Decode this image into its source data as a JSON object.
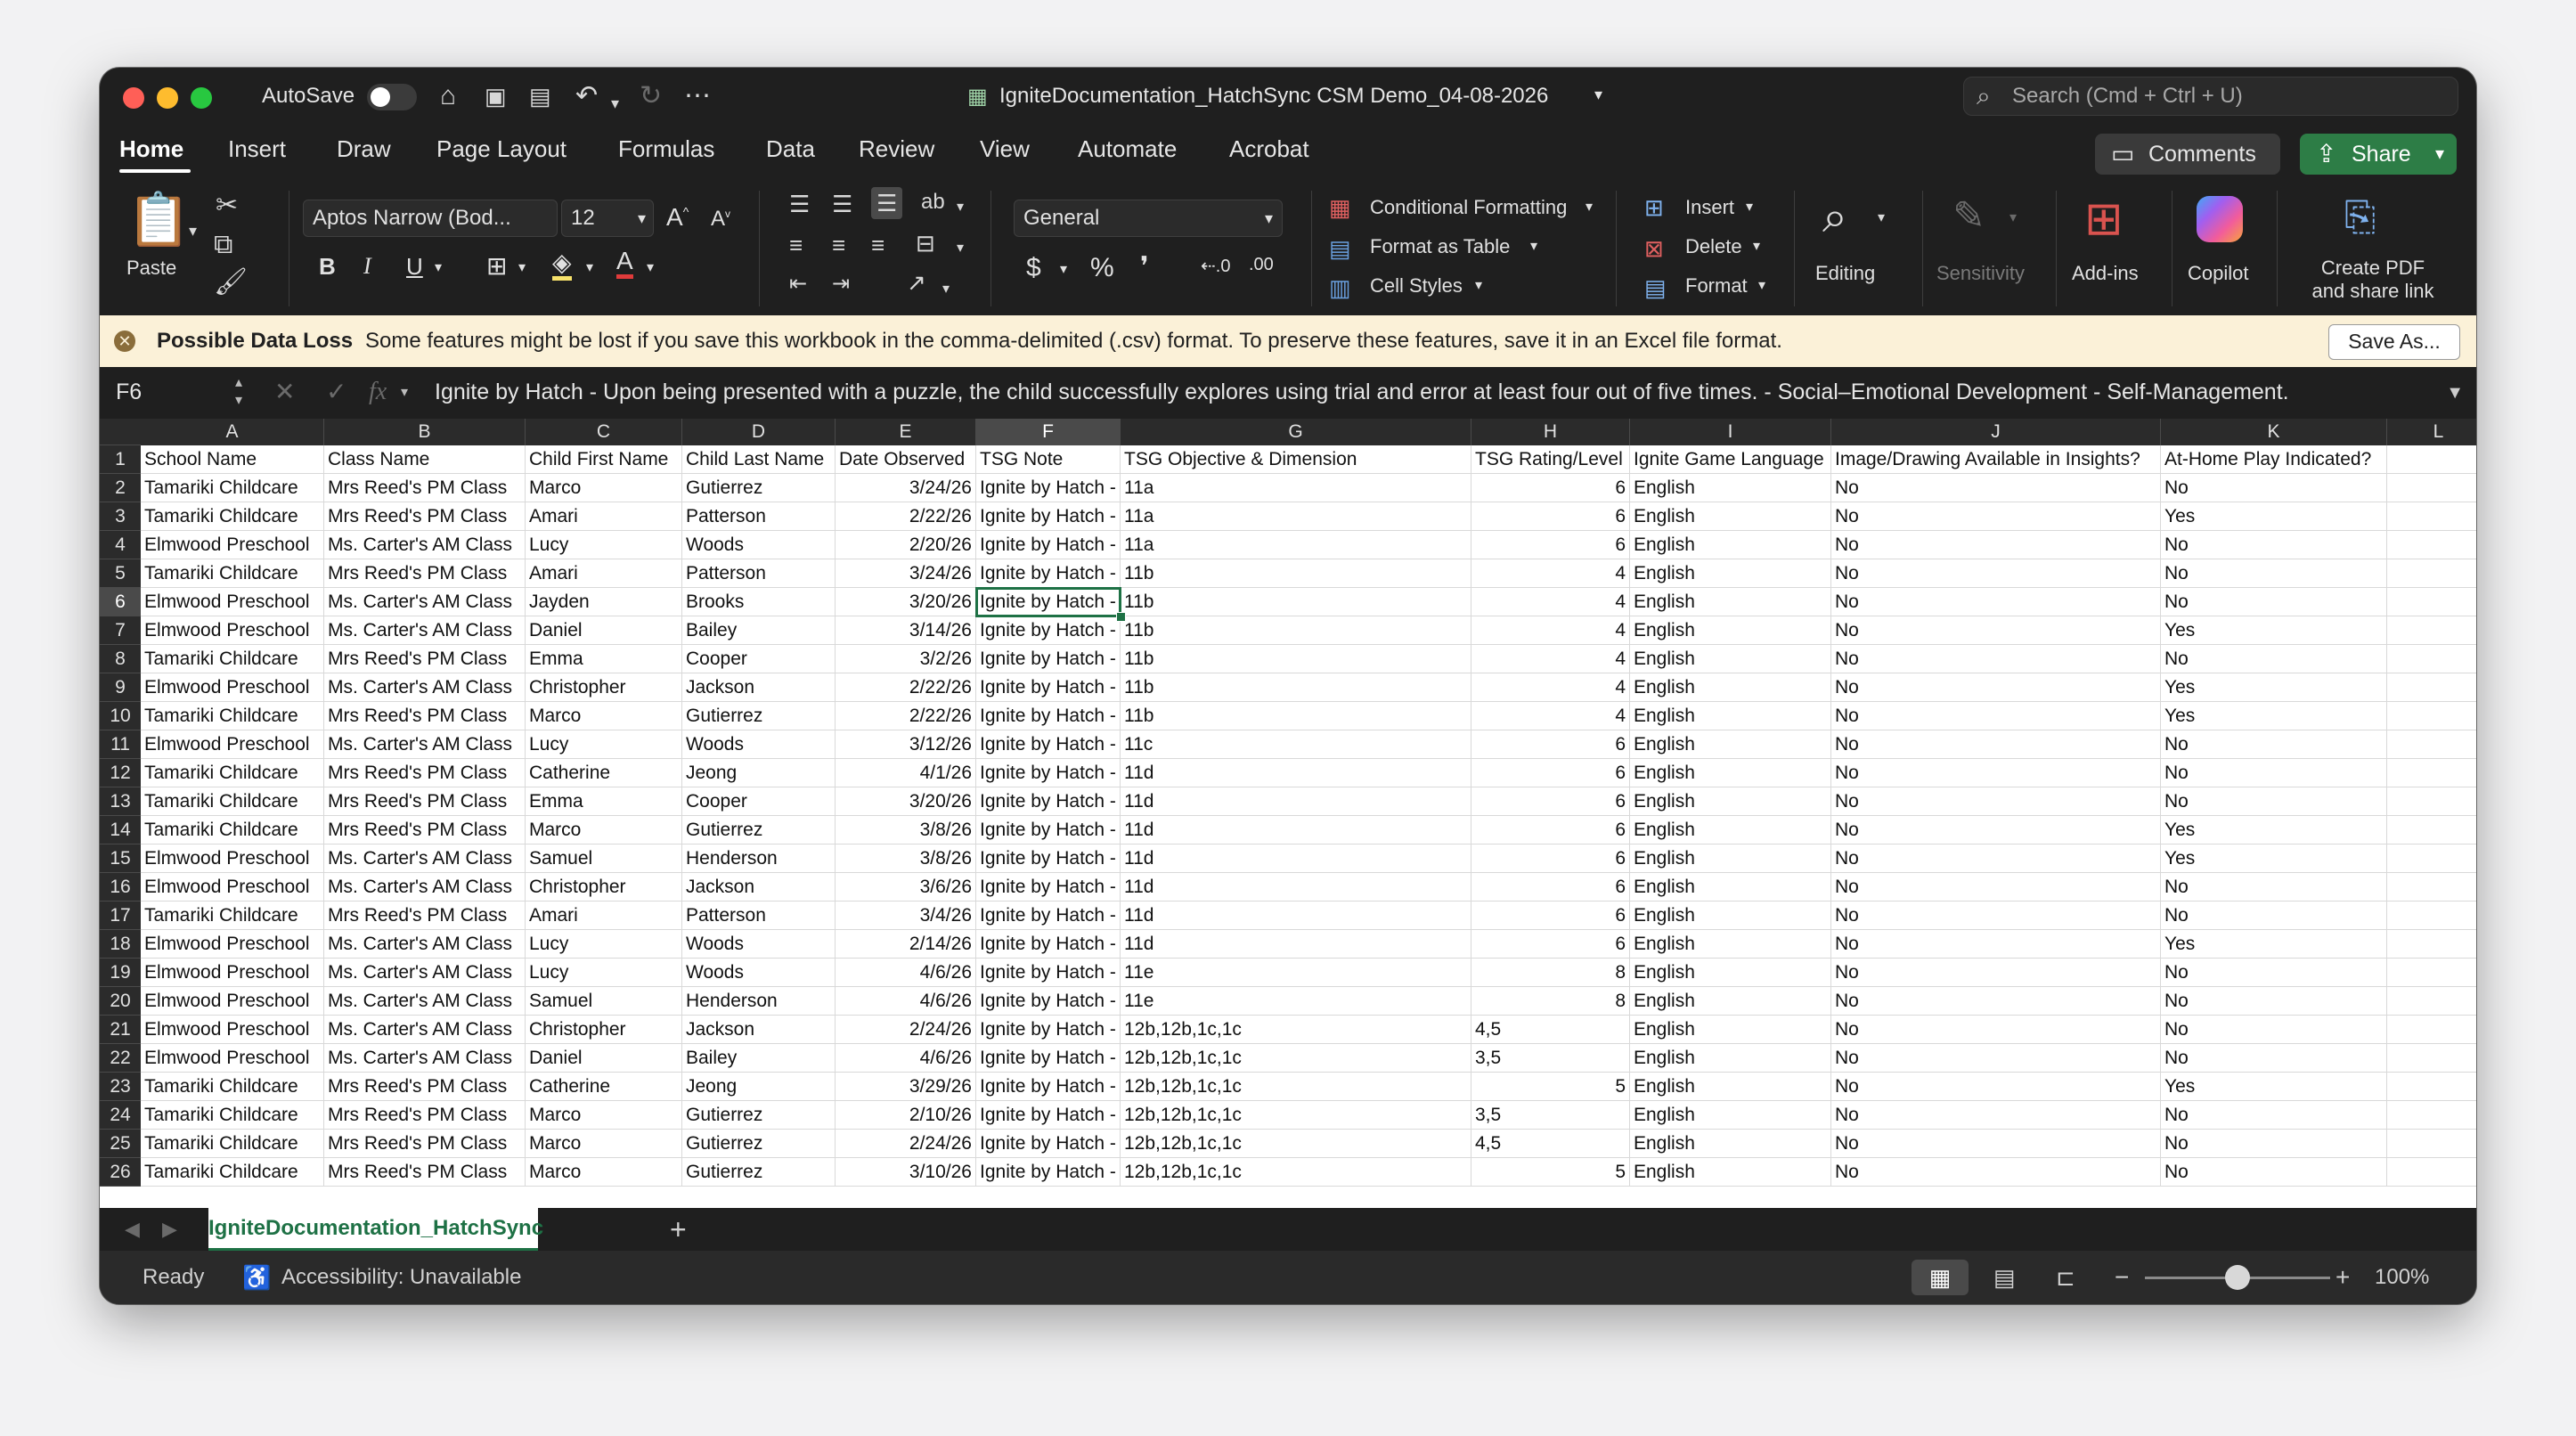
{
  "titlebar": {
    "autosave_label": "AutoSave",
    "document_title": "IgniteDocumentation_HatchSync CSM Demo_04-08-2026",
    "search_placeholder": "Search (Cmd + Ctrl + U)"
  },
  "tabs": [
    "Home",
    "Insert",
    "Draw",
    "Page Layout",
    "Formulas",
    "Data",
    "Review",
    "View",
    "Automate",
    "Acrobat"
  ],
  "actions": {
    "comments": "Comments",
    "share": "Share"
  },
  "ribbon": {
    "paste": "Paste",
    "font_name": "Aptos Narrow (Bod...",
    "font_size": "12",
    "number_format": "General",
    "conditional_formatting": "Conditional Formatting",
    "format_as_table": "Format as Table",
    "cell_styles": "Cell Styles",
    "insert": "Insert",
    "delete": "Delete",
    "format": "Format",
    "editing": "Editing",
    "sensitivity": "Sensitivity",
    "add_ins": "Add-ins",
    "copilot": "Copilot",
    "create_pdf_line1": "Create PDF",
    "create_pdf_line2": "and share link"
  },
  "banner": {
    "title": "Possible Data Loss",
    "message": "Some features might be lost if you save this workbook in the comma-delimited (.csv) format. To preserve these features, save it in an Excel file format.",
    "button": "Save As..."
  },
  "formula_bar": {
    "cell_ref": "F6",
    "content": "Ignite by Hatch - Upon being presented with a puzzle, the child successfully explores using trial and error at least four out of five times. - Social–Emotional Development - Self-Management."
  },
  "grid": {
    "selected_cell": "F6",
    "columns": [
      "A",
      "B",
      "C",
      "D",
      "E",
      "F",
      "G",
      "H",
      "I",
      "J",
      "K",
      "L"
    ],
    "headers": [
      "School Name",
      "Class Name",
      "Child First Name",
      "Child Last Name",
      "Date Observed",
      "TSG Note",
      "TSG Objective & Dimension",
      "TSG Rating/Level",
      "Ignite Game Language",
      "Image/Drawing Available in Insights?",
      "At-Home Play Indicated?"
    ],
    "rows": [
      [
        "Tamariki Childcare",
        "Mrs Reed's PM Class",
        "Marco",
        "Gutierrez",
        "3/24/26",
        "Ignite by Hatch -",
        "11a",
        "6",
        "English",
        "No",
        "No"
      ],
      [
        "Tamariki Childcare",
        "Mrs Reed's PM Class",
        "Amari",
        "Patterson",
        "2/22/26",
        "Ignite by Hatch -",
        "11a",
        "6",
        "English",
        "No",
        "Yes"
      ],
      [
        "Elmwood Preschool",
        "Ms. Carter's AM Class",
        "Lucy",
        "Woods",
        "2/20/26",
        "Ignite by Hatch -",
        "11a",
        "6",
        "English",
        "No",
        "No"
      ],
      [
        "Tamariki Childcare",
        "Mrs Reed's PM Class",
        "Amari",
        "Patterson",
        "3/24/26",
        "Ignite by Hatch -",
        "11b",
        "4",
        "English",
        "No",
        "No"
      ],
      [
        "Elmwood Preschool",
        "Ms. Carter's AM Class",
        "Jayden",
        "Brooks",
        "3/20/26",
        "Ignite by Hatch -",
        "11b",
        "4",
        "English",
        "No",
        "No"
      ],
      [
        "Elmwood Preschool",
        "Ms. Carter's AM Class",
        "Daniel",
        "Bailey",
        "3/14/26",
        "Ignite by Hatch -",
        "11b",
        "4",
        "English",
        "No",
        "Yes"
      ],
      [
        "Tamariki Childcare",
        "Mrs Reed's PM Class",
        "Emma",
        "Cooper",
        "3/2/26",
        "Ignite by Hatch -",
        "11b",
        "4",
        "English",
        "No",
        "No"
      ],
      [
        "Elmwood Preschool",
        "Ms. Carter's AM Class",
        "Christopher",
        "Jackson",
        "2/22/26",
        "Ignite by Hatch -",
        "11b",
        "4",
        "English",
        "No",
        "Yes"
      ],
      [
        "Tamariki Childcare",
        "Mrs Reed's PM Class",
        "Marco",
        "Gutierrez",
        "2/22/26",
        "Ignite by Hatch -",
        "11b",
        "4",
        "English",
        "No",
        "Yes"
      ],
      [
        "Elmwood Preschool",
        "Ms. Carter's AM Class",
        "Lucy",
        "Woods",
        "3/12/26",
        "Ignite by Hatch -",
        "11c",
        "6",
        "English",
        "No",
        "No"
      ],
      [
        "Tamariki Childcare",
        "Mrs Reed's PM Class",
        "Catherine",
        "Jeong",
        "4/1/26",
        "Ignite by Hatch -",
        "11d",
        "6",
        "English",
        "No",
        "No"
      ],
      [
        "Tamariki Childcare",
        "Mrs Reed's PM Class",
        "Emma",
        "Cooper",
        "3/20/26",
        "Ignite by Hatch -",
        "11d",
        "6",
        "English",
        "No",
        "No"
      ],
      [
        "Tamariki Childcare",
        "Mrs Reed's PM Class",
        "Marco",
        "Gutierrez",
        "3/8/26",
        "Ignite by Hatch -",
        "11d",
        "6",
        "English",
        "No",
        "Yes"
      ],
      [
        "Elmwood Preschool",
        "Ms. Carter's AM Class",
        "Samuel",
        "Henderson",
        "3/8/26",
        "Ignite by Hatch -",
        "11d",
        "6",
        "English",
        "No",
        "Yes"
      ],
      [
        "Elmwood Preschool",
        "Ms. Carter's AM Class",
        "Christopher",
        "Jackson",
        "3/6/26",
        "Ignite by Hatch -",
        "11d",
        "6",
        "English",
        "No",
        "No"
      ],
      [
        "Tamariki Childcare",
        "Mrs Reed's PM Class",
        "Amari",
        "Patterson",
        "3/4/26",
        "Ignite by Hatch -",
        "11d",
        "6",
        "English",
        "No",
        "No"
      ],
      [
        "Elmwood Preschool",
        "Ms. Carter's AM Class",
        "Lucy",
        "Woods",
        "2/14/26",
        "Ignite by Hatch -",
        "11d",
        "6",
        "English",
        "No",
        "Yes"
      ],
      [
        "Elmwood Preschool",
        "Ms. Carter's AM Class",
        "Lucy",
        "Woods",
        "4/6/26",
        "Ignite by Hatch -",
        "11e",
        "8",
        "English",
        "No",
        "No"
      ],
      [
        "Elmwood Preschool",
        "Ms. Carter's AM Class",
        "Samuel",
        "Henderson",
        "4/6/26",
        "Ignite by Hatch -",
        "11e",
        "8",
        "English",
        "No",
        "No"
      ],
      [
        "Elmwood Preschool",
        "Ms. Carter's AM Class",
        "Christopher",
        "Jackson",
        "2/24/26",
        "Ignite by Hatch -",
        "12b,12b,1c,1c",
        "4,5",
        "English",
        "No",
        "No"
      ],
      [
        "Elmwood Preschool",
        "Ms. Carter's AM Class",
        "Daniel",
        "Bailey",
        "4/6/26",
        "Ignite by Hatch -",
        "12b,12b,1c,1c",
        "3,5",
        "English",
        "No",
        "No"
      ],
      [
        "Tamariki Childcare",
        "Mrs Reed's PM Class",
        "Catherine",
        "Jeong",
        "3/29/26",
        "Ignite by Hatch -",
        "12b,12b,1c,1c",
        "5",
        "English",
        "No",
        "Yes"
      ],
      [
        "Tamariki Childcare",
        "Mrs Reed's PM Class",
        "Marco",
        "Gutierrez",
        "2/10/26",
        "Ignite by Hatch -",
        "12b,12b,1c,1c",
        "3,5",
        "English",
        "No",
        "No"
      ],
      [
        "Tamariki Childcare",
        "Mrs Reed's PM Class",
        "Marco",
        "Gutierrez",
        "2/24/26",
        "Ignite by Hatch -",
        "12b,12b,1c,1c",
        "4,5",
        "English",
        "No",
        "No"
      ],
      [
        "Tamariki Childcare",
        "Mrs Reed's PM Class",
        "Marco",
        "Gutierrez",
        "3/10/26",
        "Ignite by Hatch -",
        "12b,12b,1c,1c",
        "5",
        "English",
        "No",
        "No"
      ]
    ]
  },
  "sheet_tab": "IgniteDocumentation_HatchSync C",
  "status": {
    "ready": "Ready",
    "accessibility": "Accessibility: Unavailable",
    "zoom_percent": "100%",
    "zoom_level": 1.0
  },
  "colors": {
    "accent_green": "#1e7145",
    "share_green": "#2d7d46",
    "banner_bg": "#fbf1d8"
  }
}
